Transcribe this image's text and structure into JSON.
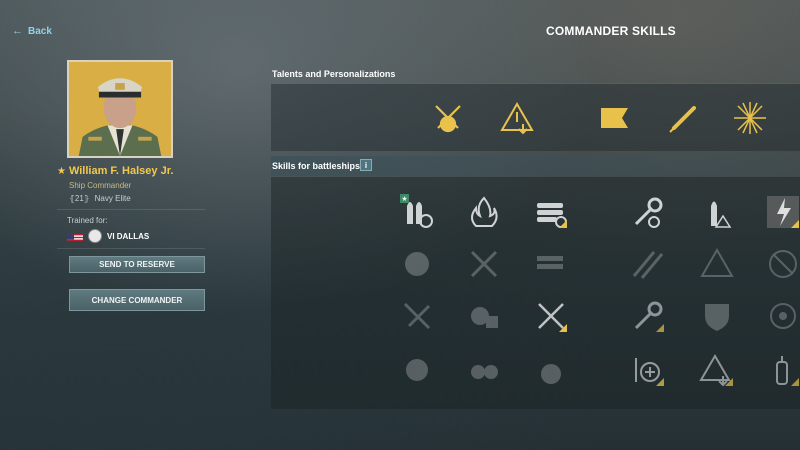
{
  "nav": {
    "back_label": "Back",
    "back_arrow": "←"
  },
  "screen": {
    "title": "COMMANDER SKILLS"
  },
  "commander": {
    "name": "William F. Halsey Jr.",
    "role": "Ship Commander",
    "level_value": "21",
    "level_text": "Navy Elite",
    "trained_label": "Trained for:",
    "ship": "VI DALLAS",
    "nation_flag": "usa-flag"
  },
  "buttons": {
    "reserve": "SEND TO RESERVE",
    "change": "CHANGE COMMANDER"
  },
  "talents": {
    "title": "Talents and Personalizations",
    "icons": [
      "crossed-anchors-icon",
      "warning-triangle-icon",
      "flag-icon",
      "torpedo-icon",
      "burst-icon"
    ]
  },
  "skills": {
    "title": "Skills for battleships",
    "info": "i",
    "rows": [
      [
        "shells-reload-icon",
        "fire-icon",
        "torpedo-launcher-icon",
        "wrench-icon",
        "shell-warning-icon",
        "hatched-bolt-icon"
      ],
      [
        "target-icon",
        "crossed-guns-icon",
        "launcher-clock-icon",
        "stripes-icon",
        "triangle-alert-icon",
        "crossed-circle-icon"
      ],
      [
        "plane-icon",
        "aa-clock-icon",
        "crossed-swords-icon",
        "wrench-clock-icon",
        "shield-icon",
        "radar-icon"
      ],
      [
        "ship-aim-icon",
        "aa-guns-icon",
        "bombs-icon",
        "repair-plus-icon",
        "alert-down-icon",
        "extinguisher-icon"
      ]
    ]
  },
  "colors": {
    "accent": "#f2c94c",
    "link": "#8fd3e8",
    "button": "#5f7a80"
  }
}
